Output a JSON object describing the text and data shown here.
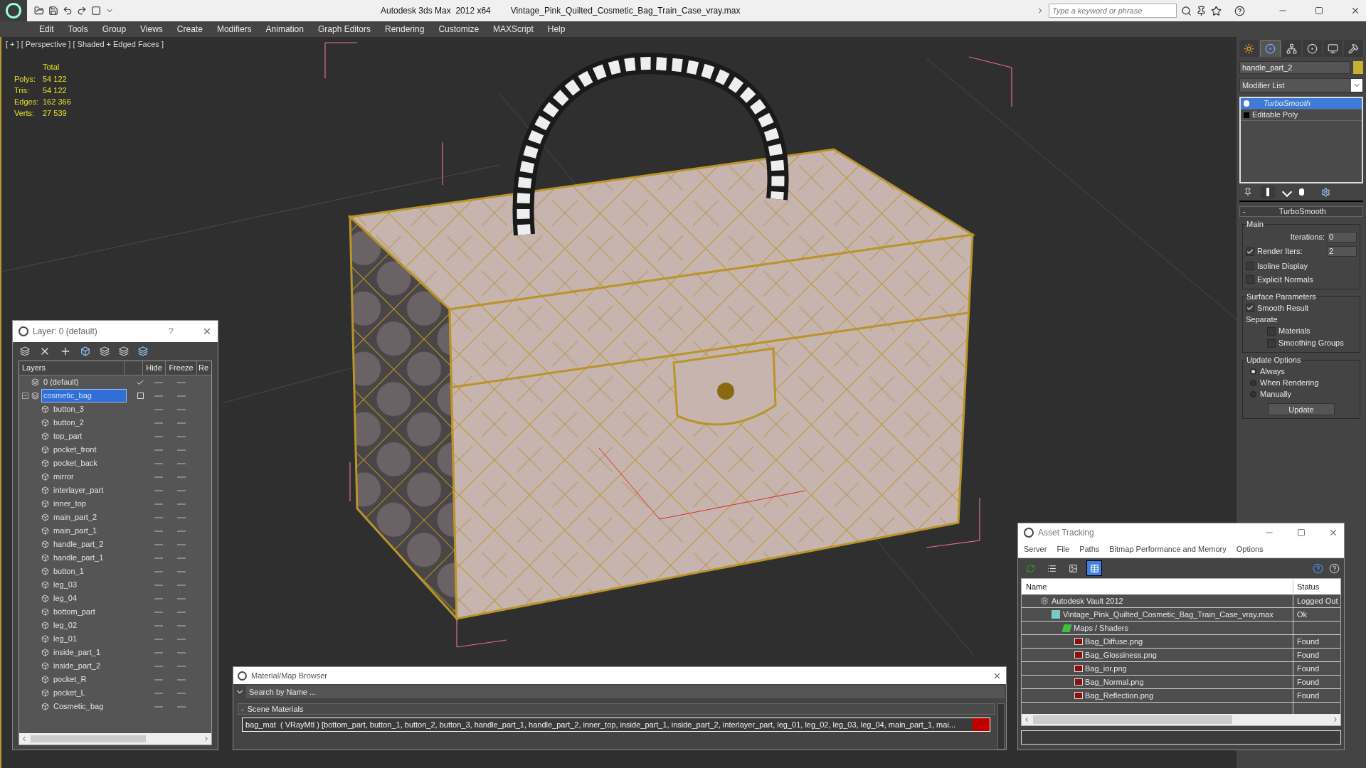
{
  "title_bar": {
    "app": "Autodesk 3ds Max  2012 x64",
    "file": "Vintage_Pink_Quilted_Cosmetic_Bag_Train_Case_vray.max",
    "search": {
      "placeholder": "Type a keyword or phrase"
    }
  },
  "menu": [
    "Edit",
    "Tools",
    "Group",
    "Views",
    "Create",
    "Modifiers",
    "Animation",
    "Graph Editors",
    "Rendering",
    "Customize",
    "MAXScript",
    "Help"
  ],
  "viewport": {
    "label": "[ + ] [ Perspective ] [ Shaded + Edged Faces ]",
    "stats_header": "Total",
    "stats": [
      {
        "label": "Polys:",
        "value": "54 122"
      },
      {
        "label": "Tris:",
        "value": "54 122"
      },
      {
        "label": "Edges:",
        "value": "162 366"
      },
      {
        "label": "Verts:",
        "value": "27 539"
      }
    ]
  },
  "layer_window": {
    "title": "Layer: 0 (default)",
    "help": "?",
    "columns": [
      "Layers",
      "Hide",
      "Freeze",
      "Re"
    ],
    "layers": [
      {
        "name": "0 (default)",
        "active": true,
        "selected": false
      },
      {
        "name": "cosmetic_bag",
        "active": false,
        "selected": true,
        "expanded": true,
        "children": [
          {
            "name": "button_3"
          },
          {
            "name": "button_2"
          },
          {
            "name": "top_part"
          },
          {
            "name": "pocket_front"
          },
          {
            "name": "pocket_back"
          },
          {
            "name": "mirror"
          },
          {
            "name": "interlayer_part"
          },
          {
            "name": "inner_top"
          },
          {
            "name": "main_part_2"
          },
          {
            "name": "main_part_1"
          },
          {
            "name": "handle_part_2"
          },
          {
            "name": "handle_part_1"
          },
          {
            "name": "button_1"
          },
          {
            "name": "leg_03"
          },
          {
            "name": "leg_04"
          },
          {
            "name": "bottom_part"
          },
          {
            "name": "leg_02"
          },
          {
            "name": "leg_01"
          },
          {
            "name": "inside_part_1"
          },
          {
            "name": "inside_part_2"
          },
          {
            "name": "pocket_R"
          },
          {
            "name": "pocket_L"
          },
          {
            "name": "Cosmetic_bag"
          }
        ]
      }
    ]
  },
  "material_browser": {
    "title": "Material/Map Browser",
    "search": {
      "placeholder": "Search by Name ..."
    },
    "section": {
      "toggle": "-",
      "title": "Scene Materials",
      "expanded": true
    },
    "items": [
      "bag_mat  ( VRayMtl ) [bottom_part, button_1, button_2, button_3, handle_part_1, handle_part_2, inner_top, inside_part_1, inside_part_2, interlayer_part, leg_01, leg_02, leg_03, leg_04, main_part_1, mai..."
    ]
  },
  "asset_tracking": {
    "title": "Asset Tracking",
    "menu": [
      "Server",
      "File",
      "Paths",
      "Bitmap Performance and Memory",
      "Options"
    ],
    "toolbar": [
      {
        "kind": "refresh",
        "selected": false
      },
      {
        "kind": "list",
        "selected": false
      },
      {
        "kind": "thumbnails",
        "selected": false
      },
      {
        "kind": "table",
        "selected": true
      }
    ],
    "columns": [
      "Name",
      "Status"
    ],
    "rows": [
      {
        "kind": "vault",
        "name": "Autodesk Vault 2012",
        "status": "Logged Out",
        "children": [
          {
            "kind": "max",
            "name": "Vintage_Pink_Quilted_Cosmetic_Bag_Train_Case_vray.max",
            "status": "Ok",
            "children": [
              {
                "kind": "folder",
                "name": "Maps / Shaders",
                "children": [
                  {
                    "kind": "png",
                    "name": "Bag_Diffuse.png",
                    "status": "Found"
                  },
                  {
                    "kind": "png",
                    "name": "Bag_Glossiness.png",
                    "status": "Found"
                  },
                  {
                    "kind": "png",
                    "name": "Bag_ior.png",
                    "status": "Found"
                  },
                  {
                    "kind": "png",
                    "name": "Bag_Normal.png",
                    "status": "Found"
                  },
                  {
                    "kind": "png",
                    "name": "Bag_Reflection.png",
                    "status": "Found"
                  }
                ]
              }
            ]
          }
        ]
      }
    ]
  },
  "command_panel": {
    "tabs": [
      {
        "kind": "create",
        "selected": false
      },
      {
        "kind": "modify",
        "selected": true
      },
      {
        "kind": "hierarchy",
        "selected": false
      },
      {
        "kind": "motion",
        "selected": false
      },
      {
        "kind": "display",
        "selected": false
      },
      {
        "kind": "utilities",
        "selected": false
      }
    ],
    "object_name": "handle_part_2",
    "modifier_list": "Modifier List",
    "stack": [
      {
        "name": "TurboSmooth",
        "selected": true,
        "kind": "modifier"
      },
      {
        "name": "Editable Poly",
        "selected": false,
        "kind": "base"
      }
    ],
    "rollout": {
      "toggle": "-",
      "title": "TurboSmooth",
      "main": {
        "title": "Main",
        "iterations": {
          "label": "Iterations:",
          "value": "0"
        },
        "render_iters": {
          "label": "Render Iters:",
          "value": "2",
          "checked": true
        },
        "options": [
          {
            "label": "Isoline Display",
            "checked": false
          },
          {
            "label": "Explicit Normals",
            "checked": false
          }
        ]
      },
      "surface": {
        "title": "Surface Parameters",
        "smooth_result": {
          "label": "Smooth Result",
          "checked": true
        },
        "separate": "Separate",
        "options": [
          {
            "label": "Materials",
            "checked": false
          },
          {
            "label": "Smoothing Groups",
            "checked": false
          }
        ]
      },
      "update": {
        "title": "Update Options",
        "options": [
          {
            "label": "Always",
            "selected": true
          },
          {
            "label": "When Rendering",
            "selected": false
          },
          {
            "label": "Manually",
            "selected": false
          }
        ],
        "button": "Update"
      }
    }
  }
}
